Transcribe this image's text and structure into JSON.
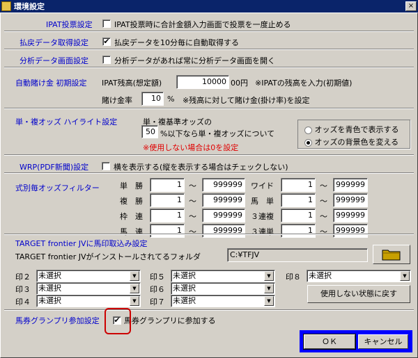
{
  "window": {
    "title": "環境設定",
    "close": "×"
  },
  "ipat": {
    "label": "IPAT投票設定",
    "checked": false,
    "text": "IPAT投票時に合計金額入力画面で投票を一度止める"
  },
  "refund": {
    "label": "払戻データ取得設定",
    "checked": true,
    "mark": "✔",
    "text": "払戻データを10分毎に自動取得する"
  },
  "analysis": {
    "label": "分析データ画面設定",
    "checked": false,
    "text": "分析データがあれば常に分析データ画面を開く"
  },
  "auto_bet": {
    "label": "自動賭け金 初期設定",
    "balance_label": "IPAT残高(想定額)",
    "balance_value": "10000",
    "balance_unit": "00円",
    "balance_note": "※IPATの残高を入力(初期値)",
    "rate_label": "賭け金率",
    "rate_value": "10",
    "rate_unit": "%",
    "rate_note": "※残高に対して賭け金(掛け率)を設定"
  },
  "highlight": {
    "label": "単・複オッズ ハイライト設定",
    "base_label": "単・複基準オッズの",
    "base_value": "50",
    "base_text": "%以下なら単・複オッズについて",
    "note": "※使用しない場合は0を設定",
    "radio1": "オッズを青色で表示する",
    "radio2": "オッズの背景色を変える",
    "selected": 2
  },
  "wrp": {
    "label": "WRP(PDF新聞)設定",
    "checked": false,
    "text": "横を表示する(縦を表示する場合はチェックしない)"
  },
  "filter": {
    "label": "式別毎オッズフィルター",
    "tilde": "～",
    "rows": [
      {
        "name1": "単　勝",
        "from1": "1",
        "to1": "999999",
        "name2": "ワイド",
        "from2": "1",
        "to2": "999999"
      },
      {
        "name1": "複　勝",
        "from1": "1",
        "to1": "999999",
        "name2": "馬　単",
        "from2": "1",
        "to2": "999999"
      },
      {
        "name1": "枠　連",
        "from1": "1",
        "to1": "999999",
        "name2": "３連複",
        "from2": "1",
        "to2": "999999"
      },
      {
        "name1": "馬　連",
        "from1": "1",
        "to1": "999999",
        "name2": "３連単",
        "from2": "1",
        "to2": "999999"
      }
    ]
  },
  "target": {
    "label": "TARGET frontier JVに馬印取込み設定",
    "folder_label": "TARGET frontier JVがインストールされてるフォルダ",
    "folder_value": "C:¥TFJV",
    "marks": [
      {
        "label": "印２",
        "value": "未選択"
      },
      {
        "label": "印３",
        "value": "未選択"
      },
      {
        "label": "印４",
        "value": "未選択"
      },
      {
        "label": "印５",
        "value": "未選択"
      },
      {
        "label": "印６",
        "value": "未選択"
      },
      {
        "label": "印７",
        "value": "未選択"
      },
      {
        "label": "印８",
        "value": "未選択"
      }
    ],
    "reset_label": "使用しない状態に戻す"
  },
  "grandprix": {
    "label": "馬券グランプリ参加設定",
    "checked": true,
    "mark": "✔",
    "text": "馬券グランプリに参加する"
  },
  "buttons": {
    "ok": "ＯＫ",
    "cancel": "キャンセル"
  },
  "colors": {
    "label_blue": "#0000cc",
    "note_red": "#e00000",
    "title_bar": "#0a246a",
    "highlight_box": "#0000ff",
    "annotation": "#cc0000"
  }
}
